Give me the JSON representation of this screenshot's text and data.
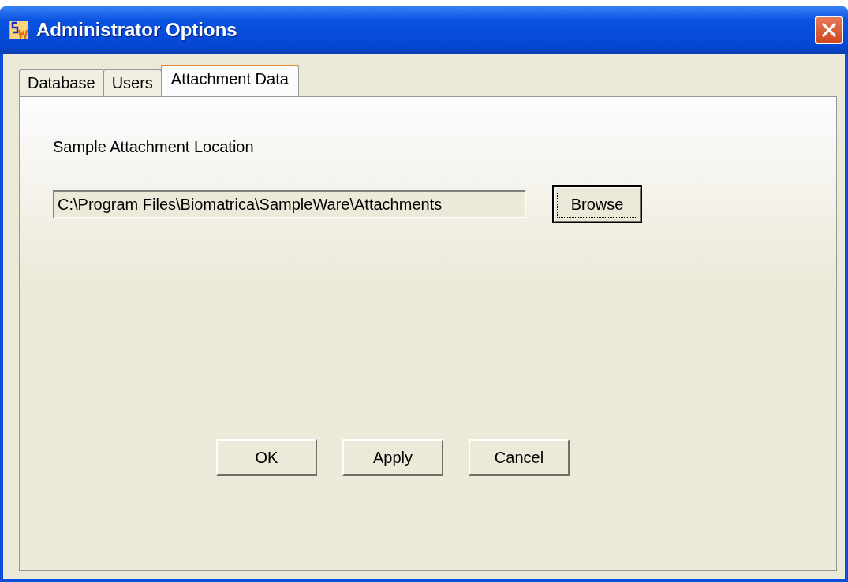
{
  "window": {
    "title": "Administrator Options"
  },
  "tabs": [
    {
      "label": "Database",
      "selected": false
    },
    {
      "label": "Users",
      "selected": false
    },
    {
      "label": "Attachment Data",
      "selected": true
    }
  ],
  "location": {
    "label": "Sample Attachment Location",
    "value": "C:\\Program Files\\Biomatrica\\SampleWare\\Attachments",
    "browse": {
      "label": "Browse",
      "focused": true
    }
  },
  "buttons": [
    {
      "label": "OK"
    },
    {
      "label": "Apply"
    },
    {
      "label": "Cancel"
    }
  ]
}
